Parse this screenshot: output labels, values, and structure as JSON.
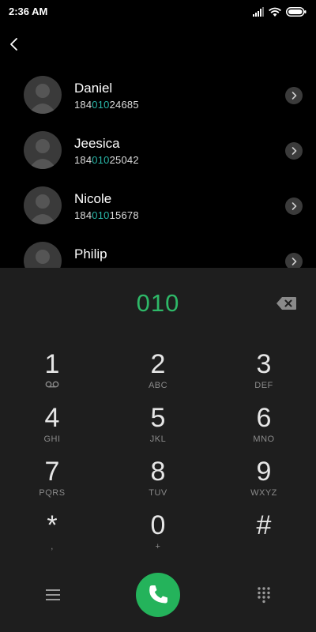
{
  "status_bar": {
    "time": "2:36 AM"
  },
  "contacts": [
    {
      "name": "Daniel",
      "number_prefix": "184",
      "number_match": "010",
      "number_suffix": "24685"
    },
    {
      "name": "Jeesica",
      "number_prefix": "184",
      "number_match": "010",
      "number_suffix": "25042"
    },
    {
      "name": "Nicole",
      "number_prefix": "184",
      "number_match": "010",
      "number_suffix": "15678"
    },
    {
      "name": "Philip",
      "number_prefix": "",
      "number_match": "",
      "number_suffix": ""
    }
  ],
  "dialpad": {
    "input": "010",
    "keys": [
      {
        "digit": "1",
        "letters": ""
      },
      {
        "digit": "2",
        "letters": "ABC"
      },
      {
        "digit": "3",
        "letters": "DEF"
      },
      {
        "digit": "4",
        "letters": "GHI"
      },
      {
        "digit": "5",
        "letters": "JKL"
      },
      {
        "digit": "6",
        "letters": "MNO"
      },
      {
        "digit": "7",
        "letters": "PQRS"
      },
      {
        "digit": "8",
        "letters": "TUV"
      },
      {
        "digit": "9",
        "letters": "WXYZ"
      },
      {
        "digit": "*",
        "letters": ","
      },
      {
        "digit": "0",
        "letters": "+"
      },
      {
        "digit": "#",
        "letters": ""
      }
    ]
  },
  "icons": {
    "status": [
      "signal-icon",
      "wifi-icon",
      "battery-icon"
    ],
    "back": "back-arrow-icon",
    "voicemail": "voicemail-icon",
    "backspace": "backspace-icon",
    "menu": "menu-icon",
    "call": "phone-icon",
    "keypad": "dialpad-icon"
  },
  "colors": {
    "accent_green": "#2eb868",
    "match_highlight": "#29b6a8",
    "call_button": "#24b35b",
    "dialpad_background": "#1e1e1e"
  }
}
